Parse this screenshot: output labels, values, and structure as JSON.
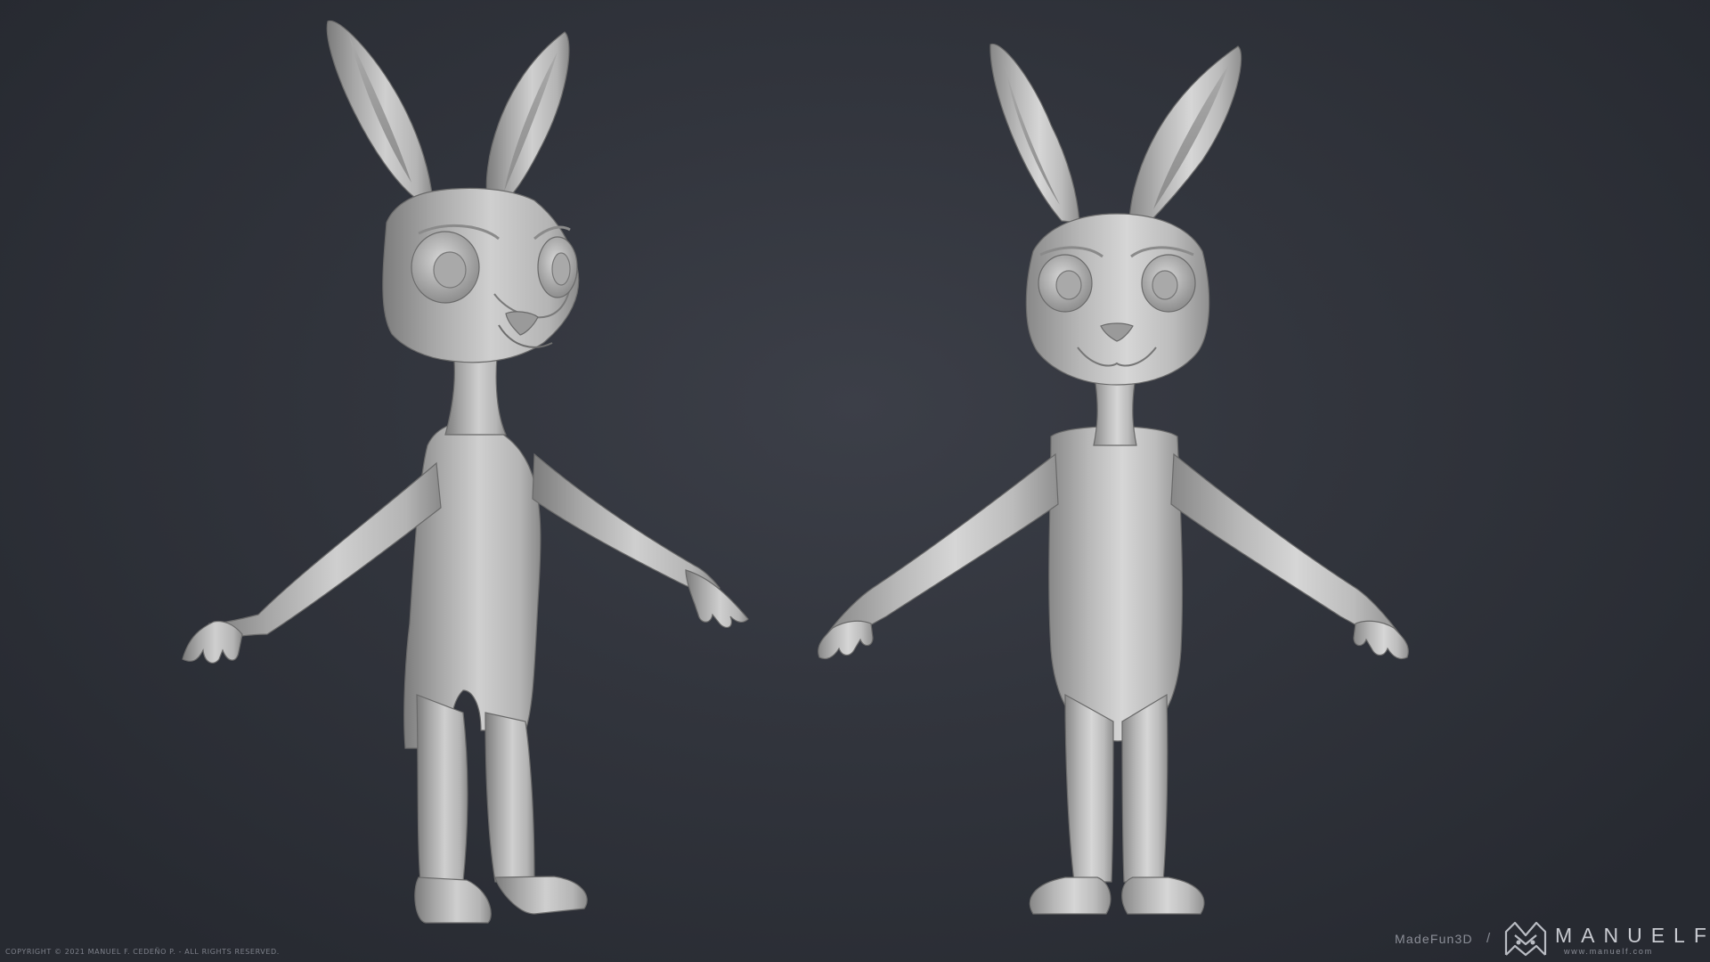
{
  "scene": {
    "description": "Two T-pose cartoon rabbit sculpts on a dark background",
    "background_color": "#32353d",
    "model_color": "#bdbdbd"
  },
  "footer": {
    "copyright": "COPYRIGHT © 2021 MANUEL F. CEDEÑO P. - ALL RIGHTS RESERVED.",
    "madefun": "MadeFun3D",
    "separator": "/",
    "brand": "MANUELF",
    "website": "www.manuelf.com"
  }
}
